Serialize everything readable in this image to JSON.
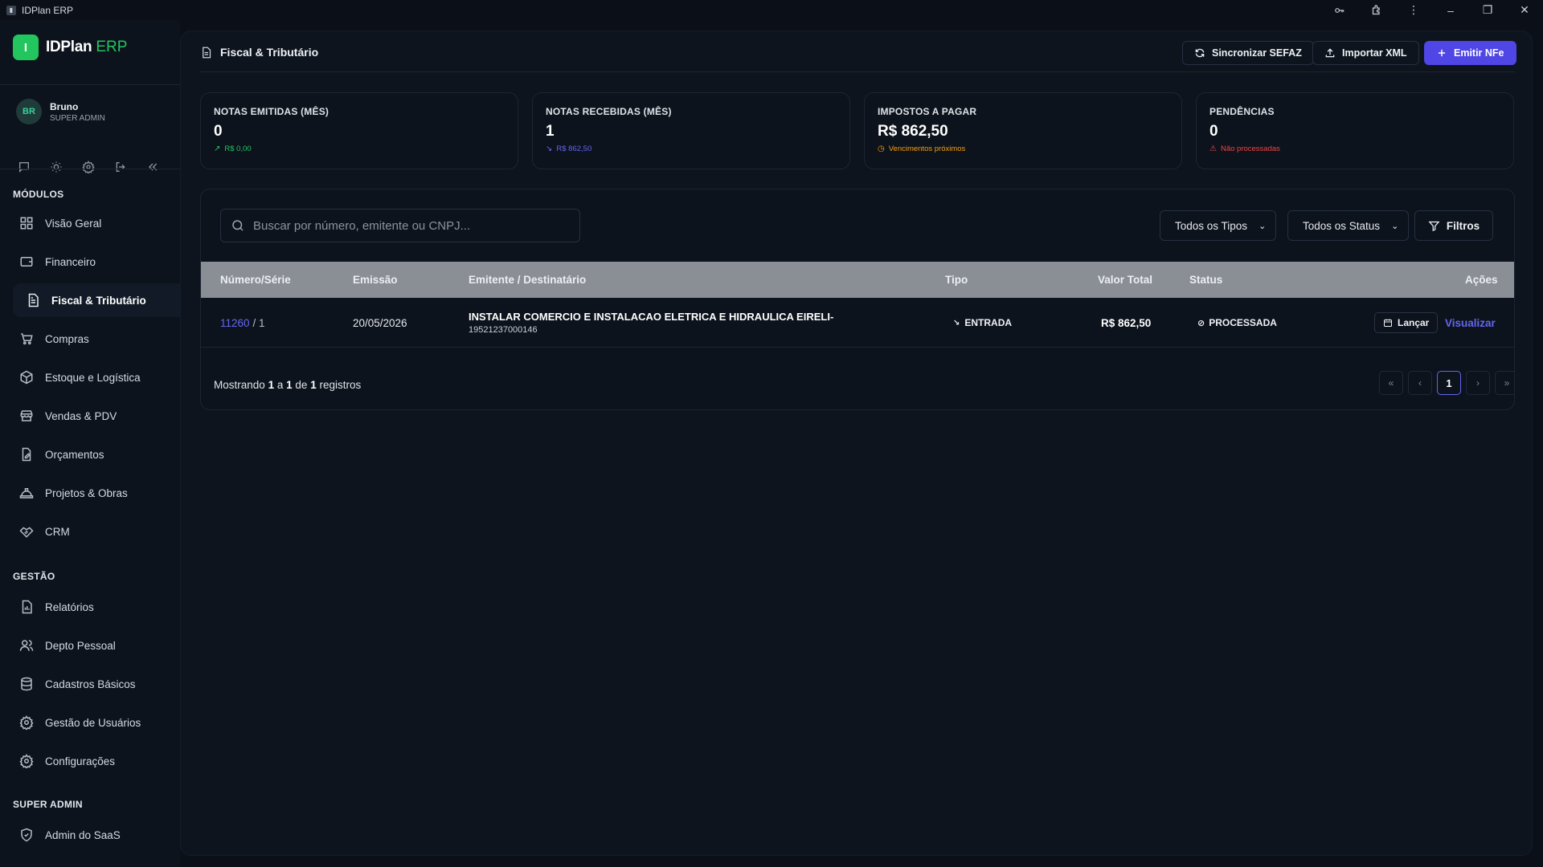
{
  "window": {
    "title": "IDPlan ERP"
  },
  "brand": {
    "name": "IDPlan",
    "suffix": "ERP",
    "mark": "I"
  },
  "user": {
    "initials": "BR",
    "name": "Bruno",
    "role": "SUPER ADMIN"
  },
  "sidebar": {
    "sections": [
      {
        "title": "MÓDULOS"
      },
      {
        "title": "GESTÃO"
      },
      {
        "title": "SUPER ADMIN"
      }
    ],
    "items": [
      {
        "label": "Visão Geral",
        "icon": "dashboard-icon"
      },
      {
        "label": "Financeiro",
        "icon": "wallet-icon"
      },
      {
        "label": "Fiscal & Tributário",
        "icon": "document-icon",
        "active": true
      },
      {
        "label": "Compras",
        "icon": "cart-icon"
      },
      {
        "label": "Estoque e Logística",
        "icon": "box-icon"
      },
      {
        "label": "Vendas & PDV",
        "icon": "store-icon"
      },
      {
        "label": "Orçamentos",
        "icon": "file-edit-icon"
      },
      {
        "label": "Projetos & Obras",
        "icon": "helmet-icon"
      },
      {
        "label": "CRM",
        "icon": "handshake-icon"
      },
      {
        "label": "Relatórios",
        "icon": "report-icon"
      },
      {
        "label": "Depto Pessoal",
        "icon": "users-icon"
      },
      {
        "label": "Cadastros Básicos",
        "icon": "database-icon"
      },
      {
        "label": "Gestão de Usuários",
        "icon": "gear-icon"
      },
      {
        "label": "Configurações",
        "icon": "gear-icon"
      },
      {
        "label": "Admin do SaaS",
        "icon": "shield-icon"
      }
    ]
  },
  "header": {
    "title": "Fiscal & Tributário",
    "buttons": {
      "sync": "Sincronizar SEFAZ",
      "import": "Importar XML",
      "emit": "Emitir NFe"
    }
  },
  "cards": [
    {
      "label": "NOTAS EMITIDAS (MÊS)",
      "value": "0",
      "sub": "R$ 0,00",
      "sub_color": "#22c55e",
      "icon": "trend-up-icon"
    },
    {
      "label": "NOTAS RECEBIDAS (MÊS)",
      "value": "1",
      "sub": "R$ 862,50",
      "sub_color": "#6366f1",
      "icon": "trend-down-icon"
    },
    {
      "label": "IMPOSTOS A PAGAR",
      "value": "R$ 862,50",
      "sub": "Vencimentos próximos",
      "sub_color": "#f59e0b",
      "icon": "clock-icon"
    },
    {
      "label": "PENDÊNCIAS",
      "value": "0",
      "sub": "Não processadas",
      "sub_color": "#ef4444",
      "icon": "alert-icon"
    }
  ],
  "search": {
    "placeholder": "Buscar por número, emitente ou CNPJ..."
  },
  "filters": {
    "type": "Todos os Tipos",
    "status": "Todos os Status",
    "button": "Filtros"
  },
  "table": {
    "columns": {
      "numero": "Número/Série",
      "emissao": "Emissão",
      "emitente": "Emitente / Destinatário",
      "tipo": "Tipo",
      "valor": "Valor Total",
      "status": "Status",
      "acoes": "Ações"
    },
    "rows": [
      {
        "numero": "11260",
        "serie": "/ 1",
        "emissao": "20/05/2026",
        "emitente": "INSTALAR COMERCIO E INSTALACAO ELETRICA E HIDRAULICA EIRELI-",
        "cnpj": "19521237000146",
        "tipo": "ENTRADA",
        "valor": "R$ 862,50",
        "status": "PROCESSADA",
        "action_lancar": "Lançar",
        "action_visualizar": "Visualizar"
      }
    ]
  },
  "footer": {
    "prefix": "Mostrando",
    "from": "1",
    "a": "a",
    "to": "1",
    "de": "de",
    "total": "1",
    "suffix": "registros"
  },
  "pagination": {
    "first": "«",
    "prev": "‹",
    "current": "1",
    "next": "›",
    "last": "»"
  }
}
